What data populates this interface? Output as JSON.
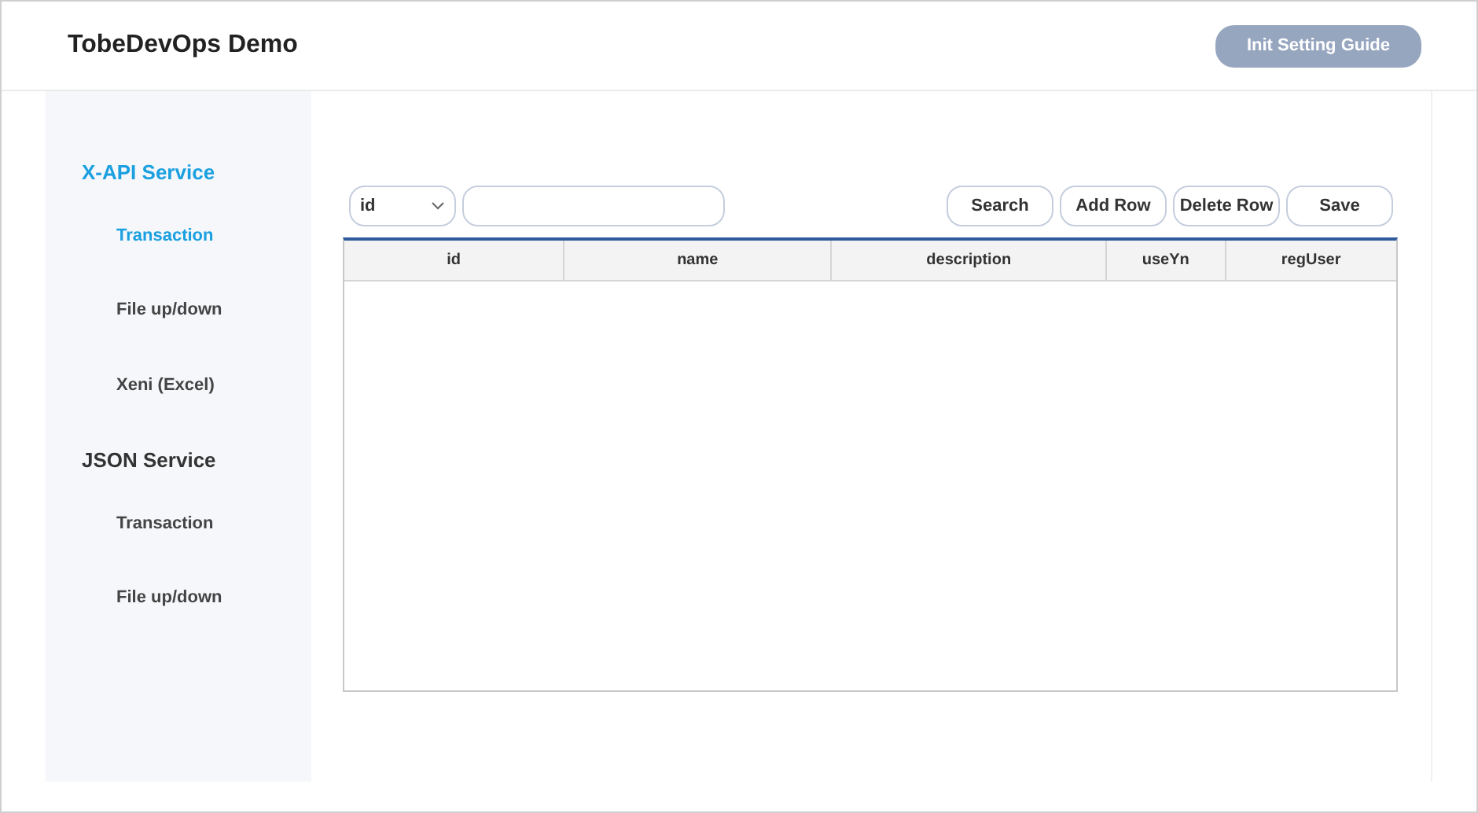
{
  "header": {
    "title": "TobeDevOps Demo",
    "guide_button": "Init Setting Guide"
  },
  "sidebar": {
    "sections": [
      {
        "title": "X-API Service",
        "selected": true,
        "items": [
          {
            "label": "Transaction",
            "selected": true
          },
          {
            "label": "File up/down",
            "selected": false
          },
          {
            "label": "Xeni (Excel)",
            "selected": false
          }
        ]
      },
      {
        "title": "JSON Service",
        "selected": false,
        "items": [
          {
            "label": "Transaction",
            "selected": false
          },
          {
            "label": "File up/down",
            "selected": false
          }
        ]
      }
    ]
  },
  "toolbar": {
    "search_field_select": "id",
    "buttons": [
      "Search",
      "Add Row",
      "Delete Row",
      "Save"
    ]
  },
  "table": {
    "columns": [
      "id",
      "name",
      "description",
      "useYn",
      "regUser"
    ]
  }
}
